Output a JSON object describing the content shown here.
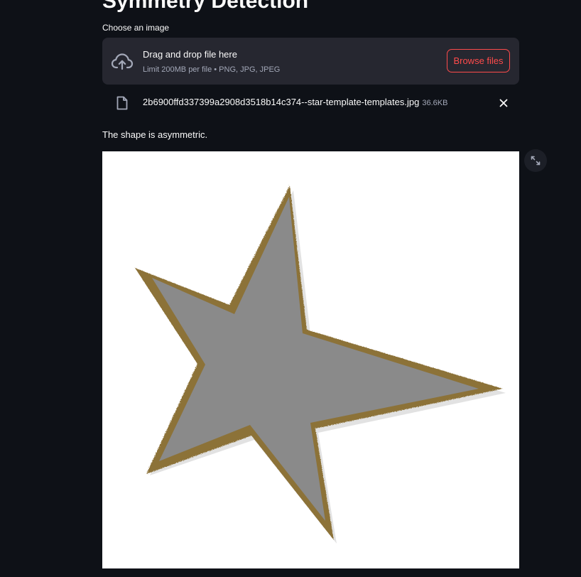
{
  "page": {
    "title": "Symmetry Detection"
  },
  "uploader": {
    "label": "Choose an image",
    "drop_title": "Drag and drop file here",
    "drop_hint": "Limit 200MB per file • PNG, JPG, JPEG",
    "browse_label": "Browse files",
    "file": {
      "name": "2b6900ffd337399a2908d3518b14c374--star-template-templates.jpg",
      "size": "36.6KB"
    }
  },
  "result": {
    "text": "The shape is asymmetric."
  },
  "colors": {
    "background": "#0e1117",
    "dropzone": "#262730",
    "accent": "#ff4b4b",
    "star_fill": "#8a8a8a",
    "star_edge": "#8c7239"
  },
  "icons": {
    "upload": "cloud-upload-icon",
    "file": "file-icon",
    "remove": "close-icon",
    "fullscreen": "expand-icon"
  }
}
